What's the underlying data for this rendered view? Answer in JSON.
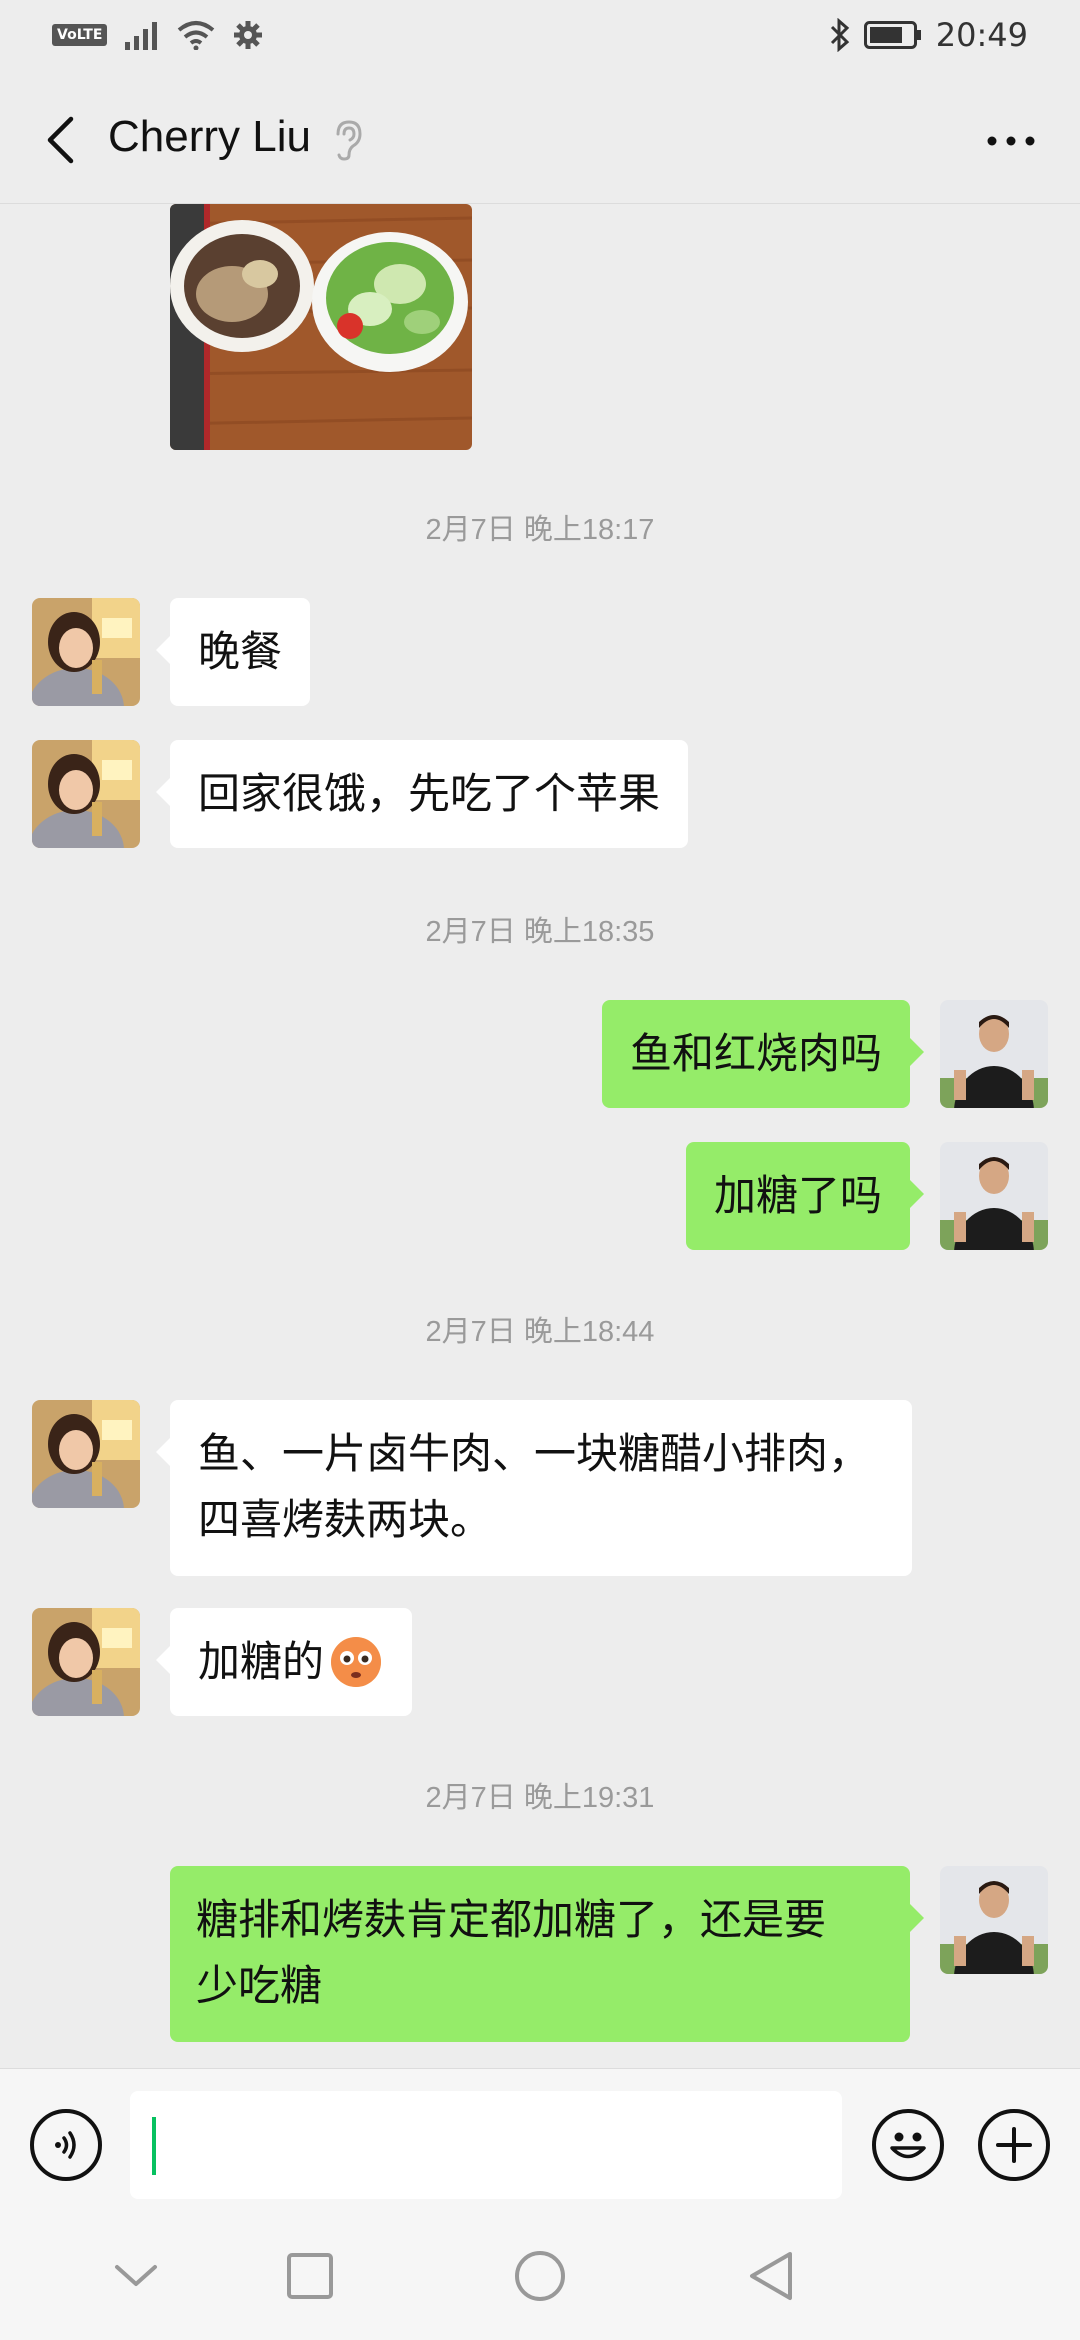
{
  "status_bar": {
    "volte": "VoLTE",
    "time": "20:49"
  },
  "header": {
    "title": "Cherry Liu"
  },
  "messages": {
    "m1": "晚餐",
    "m2": "回家很饿，先吃了个苹果",
    "m3": "鱼和红烧肉吗",
    "m4": "加糖了吗",
    "m5_line1": "鱼、一片卤牛肉、一块糖醋小排肉，",
    "m5_line2": "四喜烤麸两块。",
    "m6": "加糖的",
    "m7_line1": "糖排和烤麸肯定都加糖了，还是要",
    "m7_line2": "少吃糖"
  },
  "timestamps": {
    "t1": "2月7日 晚上18:17",
    "t2": "2月7日 晚上18:35",
    "t3": "2月7日 晚上18:44",
    "t4": "2月7日 晚上19:31"
  },
  "input": {
    "value": ""
  },
  "colors": {
    "background": "#ededed",
    "sent_bubble": "#95ec69",
    "received_bubble": "#ffffff",
    "cursor": "#07c160"
  },
  "icons": {
    "back": "chevron-left-icon",
    "hearing": "ear-icon",
    "more": "more-dots-icon",
    "voice": "voice-icon",
    "emoji": "emoji-icon",
    "plus": "plus-icon",
    "emoji_in_message": "flushed-face-emoji"
  }
}
